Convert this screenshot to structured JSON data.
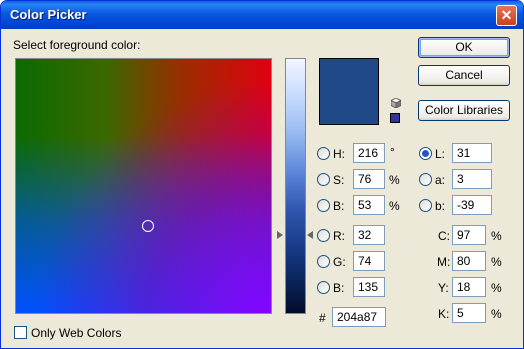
{
  "window": {
    "title": "Color Picker",
    "close_glyph": "✕"
  },
  "prompt": "Select foreground color:",
  "buttons": {
    "ok": "OK",
    "cancel": "Cancel",
    "libraries": "Color Libraries"
  },
  "current_color": "#204a87",
  "hsb": {
    "h": {
      "label": "H:",
      "value": "216",
      "unit": "°"
    },
    "s": {
      "label": "S:",
      "value": "76",
      "unit": "%"
    },
    "b": {
      "label": "B:",
      "value": "53",
      "unit": "%"
    }
  },
  "rgb": {
    "r": {
      "label": "R:",
      "value": "32"
    },
    "g": {
      "label": "G:",
      "value": "74"
    },
    "b": {
      "label": "B:",
      "value": "135"
    }
  },
  "lab": {
    "l": {
      "label": "L:",
      "value": "31"
    },
    "a": {
      "label": "a:",
      "value": "3"
    },
    "b": {
      "label": "b:",
      "value": "-39"
    }
  },
  "cmyk": {
    "c": {
      "label": "C:",
      "value": "97",
      "unit": "%"
    },
    "m": {
      "label": "M:",
      "value": "80",
      "unit": "%"
    },
    "y": {
      "label": "Y:",
      "value": "18",
      "unit": "%"
    },
    "k": {
      "label": "K:",
      "value": "5",
      "unit": "%"
    }
  },
  "hex": {
    "label": "#",
    "value": "204a87"
  },
  "only_web_colors": {
    "label": "Only Web Colors",
    "checked": false
  },
  "selected_mode": "L",
  "icons": {
    "out_of_gamut": "gamut-warning-cube-icon",
    "web_safe": "web-safe-swatch-icon"
  }
}
